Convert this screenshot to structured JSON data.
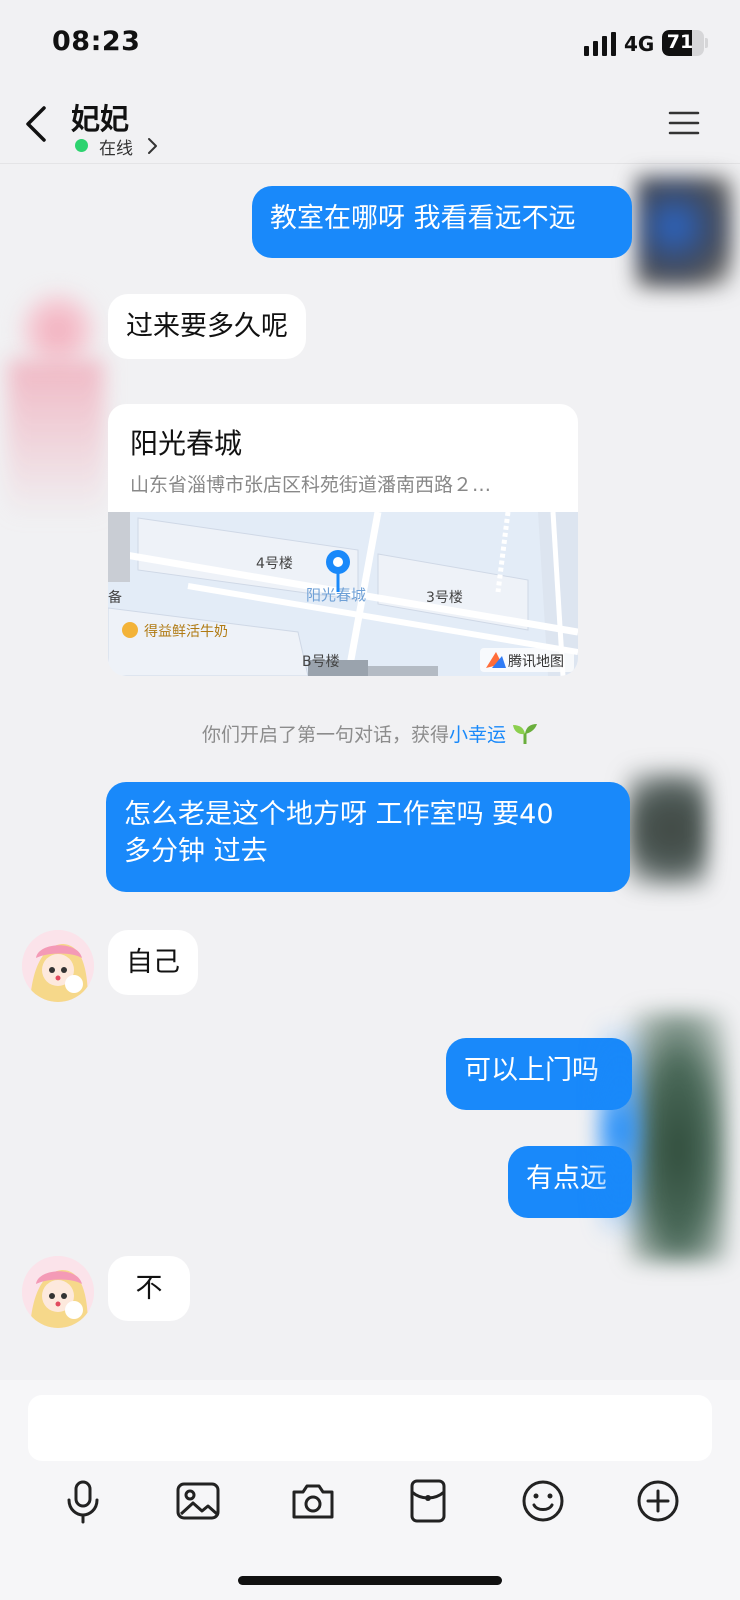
{
  "status_bar": {
    "time": "08:23",
    "network": "4G",
    "battery": "71",
    "battery_level": 0.71
  },
  "header": {
    "contact_name": "妃妃",
    "online_status": "在线"
  },
  "messages": [
    {
      "side": "out",
      "text": "教室在哪呀 我看看远不远"
    },
    {
      "side": "in",
      "text": "过来要多久呢"
    },
    {
      "side": "in",
      "type": "location",
      "title": "阳光春城",
      "address": "山东省淄博市张店区科苑街道潘南西路２…",
      "map_labels": [
        "4号楼",
        "阳光春城",
        "3号楼",
        "备",
        "得益鲜活牛奶",
        "B号楼",
        "腾讯地图"
      ]
    },
    {
      "side": "out",
      "text_line1": "怎么老是这个地方呀 工作室吗 要40",
      "text_line2": "多分钟 过去"
    },
    {
      "side": "in",
      "text": "自己"
    },
    {
      "side": "out",
      "text": "可以上门吗"
    },
    {
      "side": "out",
      "text": "有点远"
    },
    {
      "side": "in",
      "text": "不"
    }
  ],
  "system_tip": {
    "prefix": "你们开启了第一句对话，获得",
    "highlight": "小幸运"
  },
  "composer": {
    "placeholder": ""
  },
  "toolbar": [
    "mic-icon",
    "image-icon",
    "camera-icon",
    "red-packet-icon",
    "emoji-icon",
    "plus-icon"
  ],
  "colors": {
    "accent": "#1989fa",
    "online": "#2dd36f",
    "background": "#f1f1f3"
  }
}
